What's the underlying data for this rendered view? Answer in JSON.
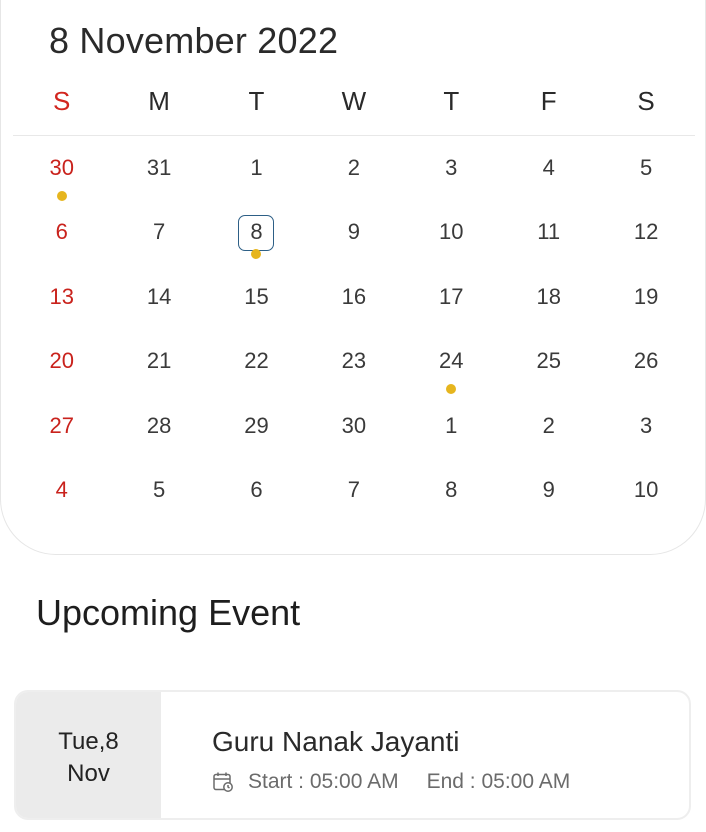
{
  "calendar": {
    "title": "8 November 2022",
    "weekdays": [
      "S",
      "M",
      "T",
      "W",
      "T",
      "F",
      "S"
    ],
    "weeks": [
      [
        "30",
        "31",
        "1",
        "2",
        "3",
        "4",
        "5"
      ],
      [
        "6",
        "7",
        "8",
        "9",
        "10",
        "11",
        "12"
      ],
      [
        "13",
        "14",
        "15",
        "16",
        "17",
        "18",
        "19"
      ],
      [
        "20",
        "21",
        "22",
        "23",
        "24",
        "25",
        "26"
      ],
      [
        "27",
        "28",
        "29",
        "30",
        "1",
        "2",
        "3"
      ],
      [
        "4",
        "5",
        "6",
        "7",
        "8",
        "9",
        "10"
      ]
    ],
    "selected_day": "8",
    "event_days": [
      "30 Oct",
      "8 Nov",
      "24 Nov"
    ],
    "colors": {
      "sunday": "#c9221c",
      "event_dot": "#e6b51e",
      "selected_border": "#2d5f86"
    }
  },
  "upcoming": {
    "title": "Upcoming Event",
    "event": {
      "date_line1": "Tue,8",
      "date_line2": "Nov",
      "name": "Guru Nanak Jayanti",
      "start": "Start : 05:00 AM",
      "end": "End : 05:00 AM",
      "icon": "calendar-clock-icon"
    }
  }
}
